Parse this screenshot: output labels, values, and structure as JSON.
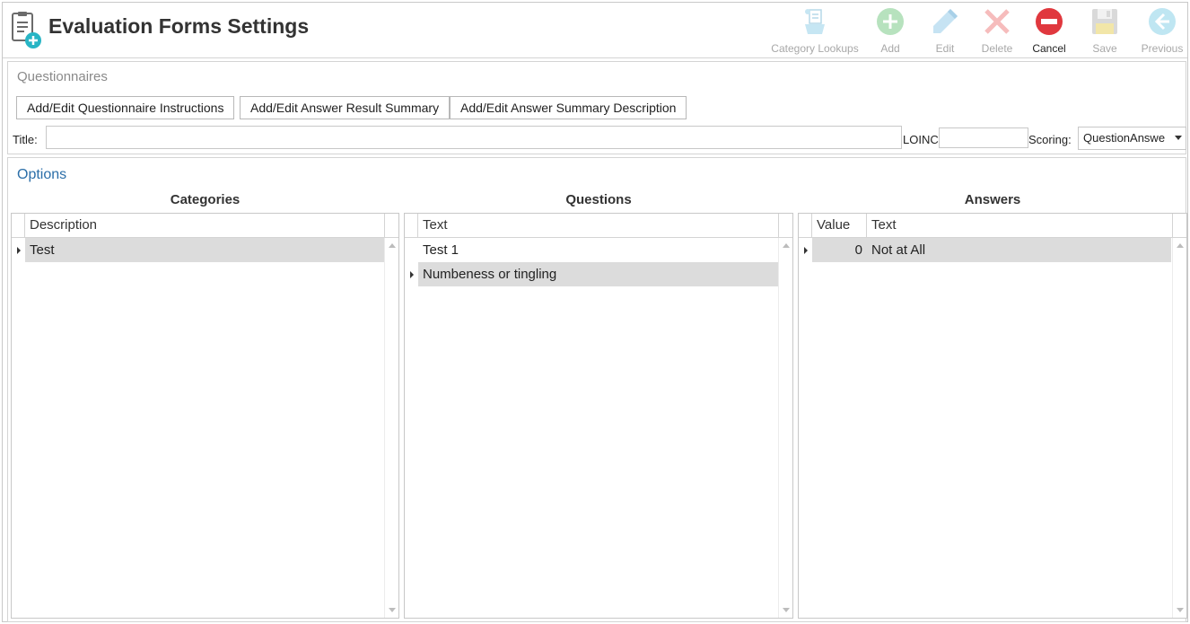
{
  "header": {
    "title": "Evaluation Forms Settings",
    "toolbar": [
      {
        "label": "Category Lookups",
        "icon": "category-lookups-icon",
        "enabled": false
      },
      {
        "label": "Add",
        "icon": "add-icon",
        "enabled": false
      },
      {
        "label": "Edit",
        "icon": "edit-icon",
        "enabled": false
      },
      {
        "label": "Delete",
        "icon": "delete-icon",
        "enabled": false
      },
      {
        "label": "Cancel",
        "icon": "cancel-icon",
        "enabled": true
      },
      {
        "label": "Save",
        "icon": "save-icon",
        "enabled": false
      },
      {
        "label": "Previous",
        "icon": "previous-icon",
        "enabled": false
      }
    ]
  },
  "questionnaires": {
    "heading": "Questionnaires",
    "buttons": [
      "Add/Edit Questionnaire Instructions",
      "Add/Edit Answer Result Summary",
      "Add/Edit Answer Summary Description"
    ],
    "title_label": "Title:",
    "title_value": "",
    "loinc_label": "LOINC",
    "loinc_value": "",
    "scoring_label": "Scoring:",
    "scoring_value": "QuestionAnswe"
  },
  "options": {
    "heading": "Options",
    "categories": {
      "title": "Categories",
      "columns": [
        "Description"
      ],
      "rows": [
        {
          "description": "Test",
          "current": true,
          "selected": true
        }
      ]
    },
    "questions": {
      "title": "Questions",
      "columns": [
        "Text"
      ],
      "rows": [
        {
          "text": "Test 1",
          "current": false,
          "selected": false
        },
        {
          "text": "Numbeness or tingling",
          "current": true,
          "selected": true
        }
      ]
    },
    "answers": {
      "title": "Answers",
      "columns": [
        "Value",
        "Text"
      ],
      "rows": [
        {
          "value": "0",
          "text": "Not at All",
          "current": true,
          "selected": true
        }
      ]
    }
  },
  "colors": {
    "accent_blue": "#2b6ea8",
    "cancel_red": "#e0383e",
    "selected_row": "#dcdcdc"
  }
}
